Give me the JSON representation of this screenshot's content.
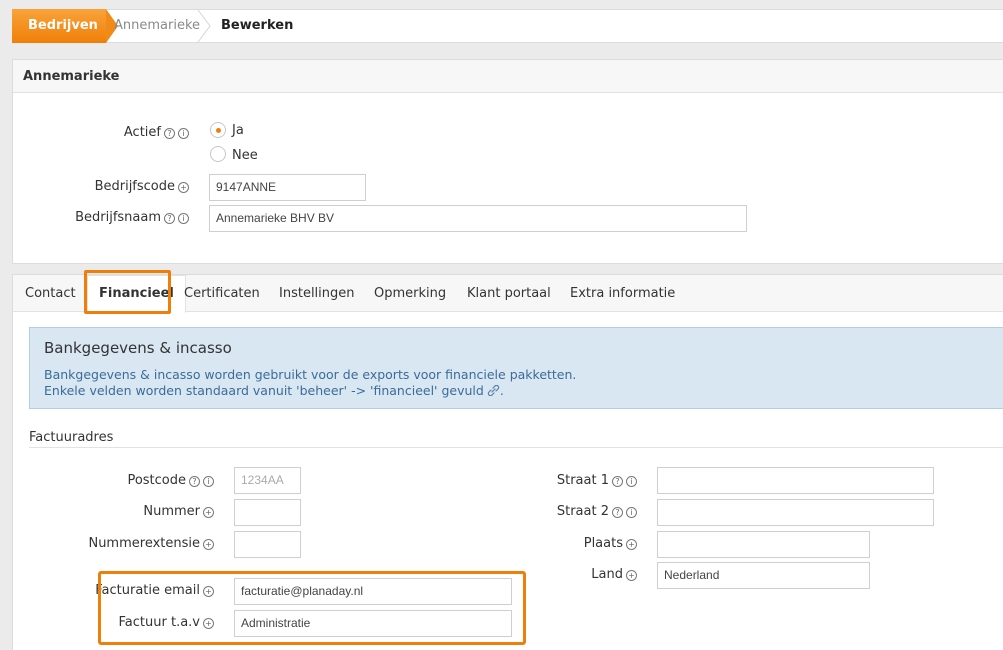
{
  "breadcrumb": {
    "home": "Bedrijven",
    "company": "Annemarieke",
    "current": "Bewerken"
  },
  "company_panel": {
    "title": "Annemarieke",
    "actief_label": "Actief",
    "radio_ja": "Ja",
    "radio_nee": "Nee",
    "selected": "Ja",
    "bedrijfscode_label": "Bedrijfscode",
    "bedrijfscode_value": "9147ANNE",
    "bedrijfsnaam_label": "Bedrijfsnaam",
    "bedrijfsnaam_value": "Annemarieke BHV BV"
  },
  "tabs": [
    "Contact",
    "Financieel",
    "Certificaten",
    "Instellingen",
    "Opmerking",
    "Klant portaal",
    "Extra informatie"
  ],
  "active_tab": "Financieel",
  "info": {
    "title": "Bankgegevens & incasso",
    "line1": "Bankgegevens & incasso worden gebruikt voor de exports voor financiele pakketten.",
    "line2": "Enkele velden worden standaard vanuit 'beheer' -> 'financieel' gevuld"
  },
  "section": "Factuuradres",
  "left_fields": {
    "postcode_label": "Postcode",
    "postcode_placeholder": "1234AA",
    "nummer_label": "Nummer",
    "nummer_value": "",
    "nummerextensie_label": "Nummerextensie",
    "nummerextensie_value": "",
    "email_label": "Facturatie email",
    "email_value": "facturatie@planaday.nl",
    "tav_label": "Factuur t.a.v",
    "tav_value": "Administratie"
  },
  "right_fields": {
    "straat1_label": "Straat 1",
    "straat1_value": "",
    "straat2_label": "Straat 2",
    "straat2_value": "",
    "plaats_label": "Plaats",
    "plaats_value": "",
    "land_label": "Land",
    "land_value": "Nederland"
  },
  "colors": {
    "accent": "#f07f09",
    "info_bg": "#d9e7f3",
    "info_text": "#3a6c98"
  }
}
